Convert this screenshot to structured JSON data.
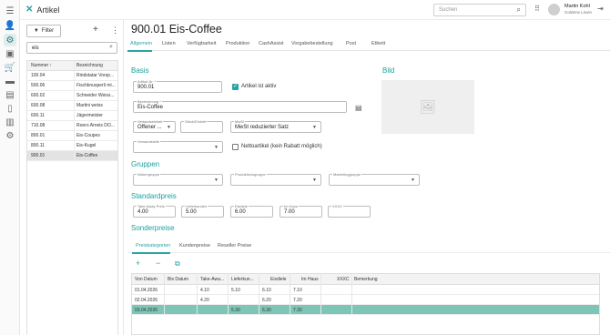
{
  "app": {
    "title": "Artikel"
  },
  "topbar": {
    "search_placeholder": "Suchen",
    "user_name": "Martin Kohl",
    "user_company": "Goldene Löwin"
  },
  "rail": {
    "icons": [
      "menu-icon",
      "person-icon",
      "gear-badge-icon",
      "briefcase-icon",
      "cart-icon",
      "truck-icon",
      "store-icon",
      "clipboard-icon",
      "chart-icon",
      "settings-icon"
    ]
  },
  "list": {
    "filter_label": "Filter",
    "search_value": "eis",
    "columns": [
      "Nummer",
      "Bezeichnung"
    ],
    "rows": [
      {
        "nummer": "100.04",
        "bezeichnung": "Rindstatar Vorsp..."
      },
      {
        "nummer": "500.06",
        "bezeichnung": "Fischknusperli mi..."
      },
      {
        "nummer": "600.02",
        "bezeichnung": "Schneider Weiss..."
      },
      {
        "nummer": "600.08",
        "bezeichnung": "Martini weiss"
      },
      {
        "nummer": "600.11",
        "bezeichnung": "Jägermeister"
      },
      {
        "nummer": "710.08",
        "bezeichnung": "Roero Arneis DO..."
      },
      {
        "nummer": "800.01",
        "bezeichnung": "Eis-Coupes"
      },
      {
        "nummer": "800.11",
        "bezeichnung": "Eis-Kugel"
      },
      {
        "nummer": "900.01",
        "bezeichnung": "Eis-Coffee"
      }
    ]
  },
  "main": {
    "title": "900.01 Eis-Coffee",
    "tabs": [
      "Allgemein",
      "Listen",
      "Verfügbarkeit",
      "Produktion",
      "CashAssist",
      "Vorgabebestellung",
      "Post",
      "Etikett"
    ],
    "active_tab": "Allgemein"
  },
  "basis": {
    "title": "Basis",
    "artikel_nr_label": "Artikel-Nr. *",
    "artikel_nr_value": "900.01",
    "aktiv_label": "Artikel ist aktiv",
    "aktiv_checked": true,
    "bezeichnung_label": "Bezeichnung *",
    "bezeichnung_value": "Eis-Coffee",
    "verkaufseinheit_label": "Verkaufseinheit",
    "verkaufseinheit_value": "Offener ...",
    "stueck_label": "Stück/Einheit",
    "mwst_label": "MwSt",
    "mwst_value": "MwSt reduzierter Satz",
    "versandstelle_label": "Versandstelle",
    "netto_label": "Nettoartikel (kein Rabatt möglich)",
    "netto_checked": false
  },
  "bild": {
    "title": "Bild"
  },
  "gruppen": {
    "title": "Gruppen",
    "warengruppe_label": "Warengruppe",
    "produktionsgruppe_label": "Produktionsgruppe",
    "marketinggruppe_label": "Marketinggruppe"
  },
  "standardpreis": {
    "title": "Standardpreis",
    "fields": [
      {
        "label": "Take-Away Preis",
        "value": "4.00"
      },
      {
        "label": "Lieferkunden",
        "value": "5.00"
      },
      {
        "label": "Eisdiele",
        "value": "6.00"
      },
      {
        "label": "Im Haus",
        "value": "7.00"
      },
      {
        "label": "XXXC",
        "value": ""
      }
    ]
  },
  "sonderpreise": {
    "title": "Sonderpreise",
    "subtabs": [
      "Preiskategorien",
      "Kundenpreise",
      "Reseller Preise"
    ],
    "active_subtab": "Preiskategorien",
    "columns": [
      "Von Datum",
      "Bis Datum",
      "Take-Awa...",
      "Lieferkun...",
      "Eisdiele",
      "Im Haus",
      "XXXC",
      "Bemerkung"
    ],
    "rows": [
      [
        "01.04.2026",
        "",
        "4.10",
        "5.10",
        "6.10",
        "7.10",
        "",
        ""
      ],
      [
        "02.04.2026",
        "",
        "4.20",
        "",
        "6.20",
        "7.20",
        "",
        ""
      ],
      [
        "03.04.2026",
        "",
        "",
        "5.30",
        "6.30",
        "7.30",
        "",
        ""
      ]
    ],
    "selected_row": 2
  },
  "colors": {
    "accent": "#2ba3a3",
    "selected_row": "#7dc6b7"
  }
}
